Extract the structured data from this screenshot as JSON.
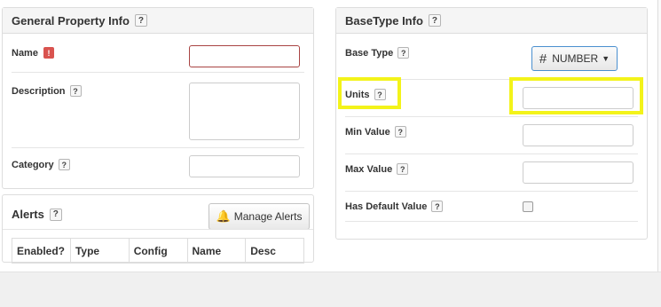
{
  "general": {
    "title": "General Property Info",
    "help": "?",
    "name_label": "Name",
    "name_error": "!",
    "name_value": "",
    "description_label": "Description",
    "description_value": "",
    "category_label": "Category",
    "category_value": ""
  },
  "alerts": {
    "title": "Alerts",
    "help": "?",
    "manage_label": "Manage Alerts",
    "columns": [
      "Enabled?",
      "Type",
      "Config",
      "Name",
      "Desc"
    ]
  },
  "basetype": {
    "title": "BaseType Info",
    "help": "?",
    "base_type_label": "Base Type",
    "base_type_value": "NUMBER",
    "base_type_symbol": "#",
    "units_label": "Units",
    "units_value": "",
    "min_label": "Min Value",
    "min_value": "",
    "max_label": "Max Value",
    "max_value": "",
    "default_label": "Has Default Value",
    "default_checked": false
  },
  "colors": {
    "highlight": "#f3f31a",
    "error": "#d9534f",
    "focus_border": "#4a8fcf"
  }
}
